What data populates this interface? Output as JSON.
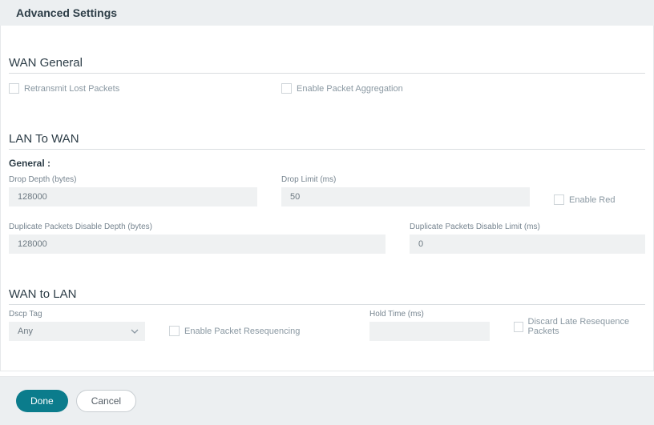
{
  "header": {
    "title": "Advanced Settings"
  },
  "wan_general": {
    "heading": "WAN General",
    "retransmit_label": "Retransmit Lost Packets",
    "aggregation_label": "Enable Packet Aggregation"
  },
  "lan_to_wan": {
    "heading": "LAN To WAN",
    "sub": "General :",
    "drop_depth_label": "Drop Depth (bytes)",
    "drop_depth_value": "128000",
    "drop_limit_label": "Drop Limit (ms)",
    "drop_limit_value": "50",
    "enable_red_label": "Enable Red",
    "dup_depth_label": "Duplicate Packets Disable Depth (bytes)",
    "dup_depth_value": "128000",
    "dup_limit_label": "Duplicate Packets Disable Limit (ms)",
    "dup_limit_value": "0"
  },
  "wan_to_lan": {
    "heading": "WAN to LAN",
    "dscp_label": "Dscp Tag",
    "dscp_value": "Any",
    "enable_reseq_label": "Enable Packet Resequencing",
    "hold_time_label": "Hold Time (ms)",
    "hold_time_value": "",
    "discard_late_label": "Discard Late Resequence Packets"
  },
  "footer": {
    "done": "Done",
    "cancel": "Cancel"
  }
}
